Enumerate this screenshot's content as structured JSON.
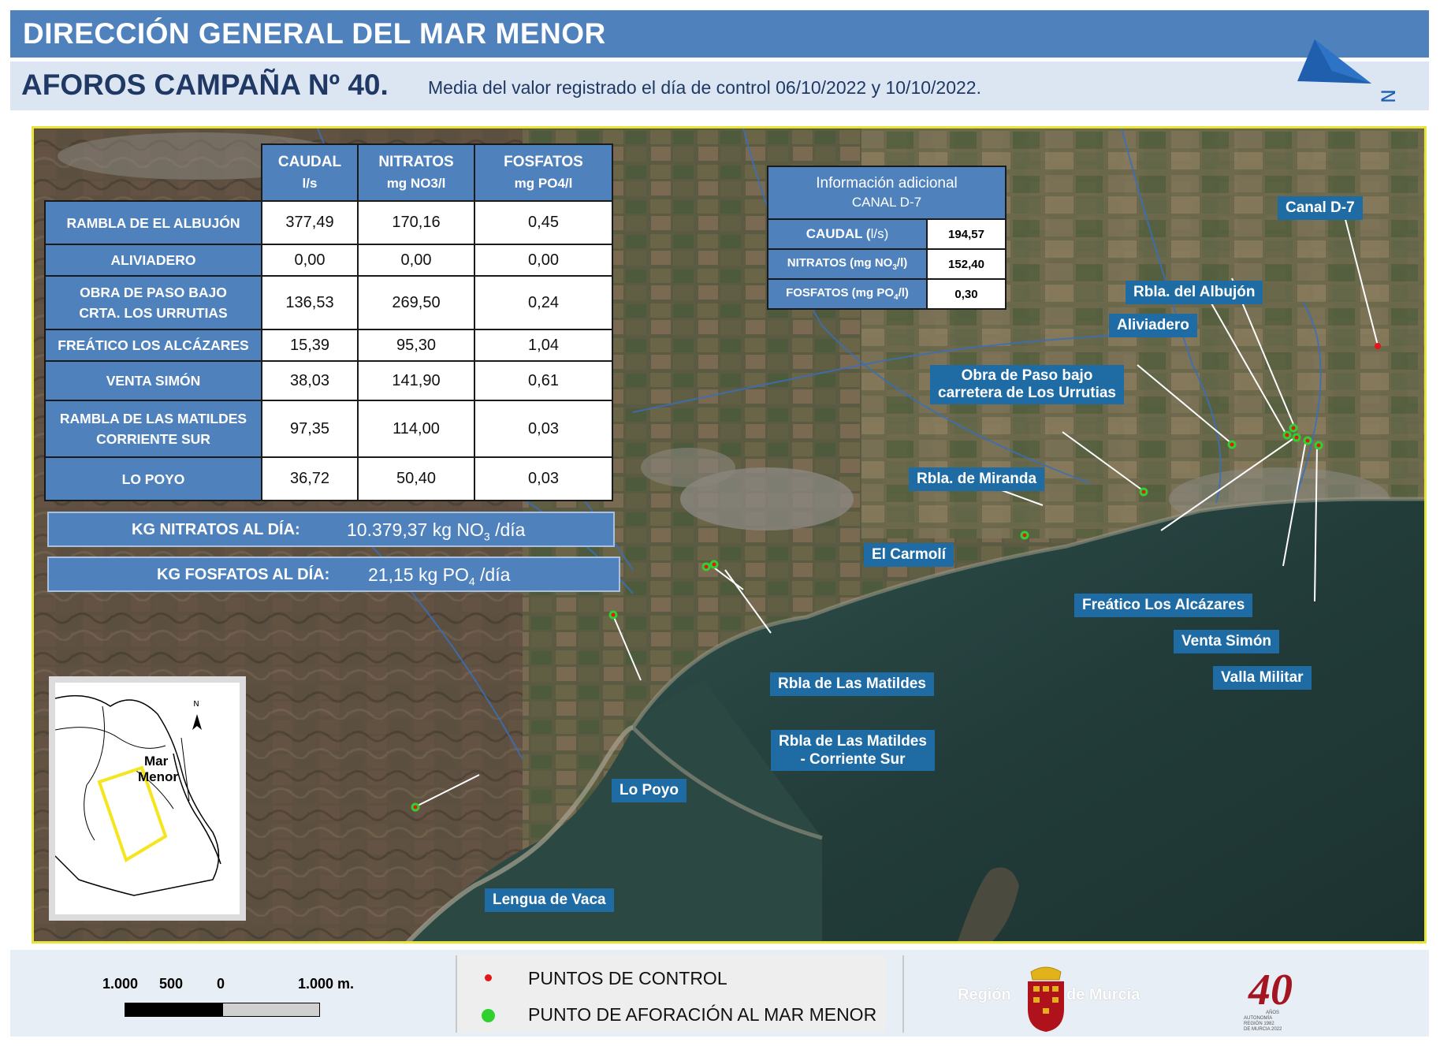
{
  "header": {
    "title": "DIRECCIÓN GENERAL DEL MAR MENOR",
    "subtitle": "AFOROS CAMPAÑA  Nº 40.",
    "description": "Media del valor registrado el día de control  06/10/2022 y 10/10/2022."
  },
  "north_arrow_letter": "N",
  "table": {
    "headers": [
      {
        "line1": "CAUDAL",
        "line2": "l/s"
      },
      {
        "line1": "NITRATOS",
        "line2": "mg NO3/l"
      },
      {
        "line1": "FOSFATOS",
        "line2": "mg PO4/l"
      }
    ],
    "rows": [
      {
        "name": "RAMBLA DE EL ALBUJÓN",
        "caudal": "377,49",
        "nitratos": "170,16",
        "fosfatos": "0,45"
      },
      {
        "name": "ALIVIADERO",
        "caudal": "0,00",
        "nitratos": "0,00",
        "fosfatos": "0,00"
      },
      {
        "name": "OBRA DE PASO BAJO CRTA. LOS URRUTIAS",
        "caudal": "136,53",
        "nitratos": "269,50",
        "fosfatos": "0,24"
      },
      {
        "name": "FREÁTICO  LOS ALCÁZARES",
        "caudal": "15,39",
        "nitratos": "95,30",
        "fosfatos": "1,04"
      },
      {
        "name": "VENTA SIMÓN",
        "caudal": "38,03",
        "nitratos": "141,90",
        "fosfatos": "0,61"
      },
      {
        "name": "RAMBLA DE LAS MATILDES CORRIENTE SUR",
        "caudal": "97,35",
        "nitratos": "114,00",
        "fosfatos": "0,03"
      },
      {
        "name": "LO POYO",
        "caudal": "36,72",
        "nitratos": "50,40",
        "fosfatos": "0,03"
      }
    ]
  },
  "totals": {
    "nitratos_label": "KG NITRATOS AL DÍA:",
    "nitratos_value": "10.379,37 kg NO",
    "nitratos_sub": "3",
    "nitratos_unit": " /día",
    "fosfatos_label": "KG FOSFATOS AL DÍA:",
    "fosfatos_value": "21,15 kg PO",
    "fosfatos_sub": "4",
    "fosfatos_unit": " /día"
  },
  "additional_info": {
    "title_line1": "Información adicional",
    "title_line2": "CANAL D-7",
    "rows": [
      {
        "label_main": "CAUDAL (",
        "label_sub": "",
        "label_end": "l/s)",
        "value": "194,57"
      },
      {
        "label_main": "NITRATOS (mg NO",
        "label_sub": "3",
        "label_end": "/l)",
        "value": "152,40"
      },
      {
        "label_main": "FOSFATOS (mg PO",
        "label_sub": "4",
        "label_end": "/l)",
        "value": "0,30"
      }
    ]
  },
  "map_labels": {
    "canal_d7": "Canal D-7",
    "rbla_albujon": "Rbla. del Albujón",
    "aliviadero": "Aliviadero",
    "obra_paso_1": "Obra de Paso bajo",
    "obra_paso_2": "carretera de Los Urrutias",
    "rbla_miranda": "Rbla. de Miranda",
    "el_carmoli": "El Carmolí",
    "freatico": "Freático Los Alcázares",
    "venta_simon": "Venta Simón",
    "valla_militar": "Valla Militar",
    "rbla_matildes": "Rbla de Las Matildes",
    "rbla_matildes_cs_1": "Rbla de Las Matildes",
    "rbla_matildes_cs_2": "- Corriente Sur",
    "lo_poyo": "Lo Poyo",
    "lengua_vaca": "Lengua de Vaca"
  },
  "inset": {
    "label_line1": "Mar",
    "label_line2": "Menor",
    "north": "N"
  },
  "scale": {
    "labels": [
      "1.000",
      "500",
      "0",
      "1.000"
    ],
    "unit": "m."
  },
  "legend": {
    "items": [
      {
        "label": "PUNTOS DE CONTROL",
        "color": "#e8141c"
      },
      {
        "label": "PUNTO DE AFORACIÓN AL MAR MENOR",
        "color": "#2fd12f"
      }
    ]
  },
  "logos": {
    "region_left": "Región",
    "region_right": "de Murcia",
    "anniv_number": "40",
    "anniv_line1": "AÑOS",
    "anniv_line2": "AUTONOMÍA",
    "anniv_line3": "REGIÓN 1982",
    "anniv_line4": "DE MURCIA 2022"
  },
  "colors": {
    "header_blue": "#4f81bd",
    "label_blue": "#1f6ba4",
    "map_border_yellow": "#e8e43a"
  }
}
